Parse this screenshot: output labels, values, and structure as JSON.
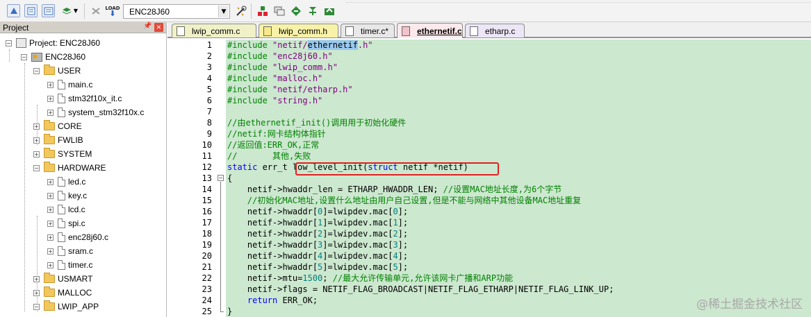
{
  "toolbar": {
    "target_value": "ENC28J60",
    "buttons": [
      "translate-icon",
      "build-icon",
      "rebuild-icon",
      "batch-build-icon",
      "stop-icon",
      "download-icon",
      "target-options-icon",
      "manage-components-icon",
      "file-extensions-icon",
      "runtime-env-icon",
      "pack-installer-icon"
    ]
  },
  "panel": {
    "title": "Project",
    "pin_glyph": "◀",
    "close_glyph": "×"
  },
  "tree": [
    {
      "label": "Project: ENC28J60",
      "kind": "project",
      "depth": 0,
      "expander": "−"
    },
    {
      "label": "ENC28J60",
      "kind": "target",
      "depth": 1,
      "expander": "−"
    },
    {
      "label": "USER",
      "kind": "folder",
      "depth": 2,
      "expander": "−"
    },
    {
      "label": "main.c",
      "kind": "file",
      "depth": 3,
      "expander": "+"
    },
    {
      "label": "stm32f10x_it.c",
      "kind": "file",
      "depth": 3,
      "expander": "+"
    },
    {
      "label": "system_stm32f10x.c",
      "kind": "file",
      "depth": 3,
      "expander": "+"
    },
    {
      "label": "CORE",
      "kind": "folder",
      "depth": 2,
      "expander": "+"
    },
    {
      "label": "FWLIB",
      "kind": "folder",
      "depth": 2,
      "expander": "+"
    },
    {
      "label": "SYSTEM",
      "kind": "folder",
      "depth": 2,
      "expander": "+"
    },
    {
      "label": "HARDWARE",
      "kind": "folder",
      "depth": 2,
      "expander": "−"
    },
    {
      "label": "led.c",
      "kind": "file",
      "depth": 3,
      "expander": "+"
    },
    {
      "label": "key.c",
      "kind": "file",
      "depth": 3,
      "expander": "+"
    },
    {
      "label": "lcd.c",
      "kind": "file",
      "depth": 3,
      "expander": "+"
    },
    {
      "label": "spi.c",
      "kind": "file",
      "depth": 3,
      "expander": "+"
    },
    {
      "label": "enc28j60.c",
      "kind": "file",
      "depth": 3,
      "expander": "+"
    },
    {
      "label": "sram.c",
      "kind": "file",
      "depth": 3,
      "expander": "+"
    },
    {
      "label": "timer.c",
      "kind": "file",
      "depth": 3,
      "expander": "+"
    },
    {
      "label": "USMART",
      "kind": "folder",
      "depth": 2,
      "expander": "+"
    },
    {
      "label": "MALLOC",
      "kind": "folder",
      "depth": 2,
      "expander": "+"
    },
    {
      "label": "LWIP_APP",
      "kind": "folder",
      "depth": 2,
      "expander": "−"
    }
  ],
  "tabs": [
    {
      "label": "lwip_comm.c",
      "color": "#f1f1c8",
      "active": false
    },
    {
      "label": "lwip_comm.h",
      "color": "#f7f2a8",
      "active": false
    },
    {
      "label": "timer.c*",
      "color": "#e8e8e8",
      "active": false
    },
    {
      "label": "ethernetif.c",
      "color": "#fde9ec",
      "active": true
    },
    {
      "label": "etharp.c",
      "color": "#ece6f7",
      "active": false
    }
  ],
  "code_lines": [
    {
      "n": "1",
      "fold": "",
      "segs": [
        [
          "pp",
          "#include "
        ],
        [
          "str",
          "\"netif/"
        ],
        [
          "sel",
          "ethernetif"
        ],
        [
          "str",
          ".h\""
        ]
      ]
    },
    {
      "n": "2",
      "fold": "",
      "segs": [
        [
          "pp",
          "#include "
        ],
        [
          "str",
          "\"enc28j60.h\""
        ]
      ]
    },
    {
      "n": "3",
      "fold": "",
      "segs": [
        [
          "pp",
          "#include "
        ],
        [
          "str",
          "\"lwip_comm.h\""
        ]
      ]
    },
    {
      "n": "4",
      "fold": "",
      "segs": [
        [
          "pp",
          "#include "
        ],
        [
          "str",
          "\"malloc.h\""
        ]
      ]
    },
    {
      "n": "5",
      "fold": "",
      "segs": [
        [
          "pp",
          "#include "
        ],
        [
          "str",
          "\"netif/etharp.h\""
        ]
      ]
    },
    {
      "n": "6",
      "fold": "",
      "segs": [
        [
          "pp",
          "#include "
        ],
        [
          "str",
          "\"string.h\""
        ]
      ]
    },
    {
      "n": "7",
      "fold": "",
      "segs": []
    },
    {
      "n": "8",
      "fold": "",
      "segs": [
        [
          "cmt",
          "//由ethernetif_init()调用用于初始化硬件"
        ]
      ]
    },
    {
      "n": "9",
      "fold": "",
      "segs": [
        [
          "cmt",
          "//netif:网卡结构体指针"
        ]
      ]
    },
    {
      "n": "10",
      "fold": "",
      "segs": [
        [
          "cmt",
          "//返回值:ERR_OK,正常"
        ]
      ]
    },
    {
      "n": "11",
      "fold": "",
      "segs": [
        [
          "cmt",
          "//       其他,失败"
        ]
      ]
    },
    {
      "n": "12",
      "fold": "",
      "segs": [
        [
          "kw",
          "static"
        ],
        [
          "",
          " err_t low_level_init("
        ],
        [
          "kw",
          "struct"
        ],
        [
          "",
          " netif *netif)"
        ]
      ]
    },
    {
      "n": "13",
      "fold": "box",
      "segs": [
        [
          "",
          "{"
        ]
      ]
    },
    {
      "n": "14",
      "fold": "line",
      "segs": [
        [
          "",
          "    netif->hwaddr_len = ETHARP_HWADDR_LEN; "
        ],
        [
          "cmt",
          "//设置MAC地址长度,为6个字节"
        ]
      ]
    },
    {
      "n": "15",
      "fold": "line",
      "segs": [
        [
          "cmt",
          "    //初始化MAC地址,设置什么地址由用户自己设置,但是不能与网络中其他设备MAC地址重复"
        ]
      ]
    },
    {
      "n": "16",
      "fold": "line",
      "segs": [
        [
          "",
          "    netif->hwaddr["
        ],
        [
          "num",
          "0"
        ],
        [
          "",
          "]=lwipdev.mac["
        ],
        [
          "num",
          "0"
        ],
        [
          "",
          "];"
        ]
      ]
    },
    {
      "n": "17",
      "fold": "line",
      "segs": [
        [
          "",
          "    netif->hwaddr["
        ],
        [
          "num",
          "1"
        ],
        [
          "",
          "]=lwipdev.mac["
        ],
        [
          "num",
          "1"
        ],
        [
          "",
          "];"
        ]
      ]
    },
    {
      "n": "18",
      "fold": "line",
      "segs": [
        [
          "",
          "    netif->hwaddr["
        ],
        [
          "num",
          "2"
        ],
        [
          "",
          "]=lwipdev.mac["
        ],
        [
          "num",
          "2"
        ],
        [
          "",
          "];"
        ]
      ]
    },
    {
      "n": "19",
      "fold": "line",
      "segs": [
        [
          "",
          "    netif->hwaddr["
        ],
        [
          "num",
          "3"
        ],
        [
          "",
          "]=lwipdev.mac["
        ],
        [
          "num",
          "3"
        ],
        [
          "",
          "];"
        ]
      ]
    },
    {
      "n": "20",
      "fold": "line",
      "segs": [
        [
          "",
          "    netif->hwaddr["
        ],
        [
          "num",
          "4"
        ],
        [
          "",
          "]=lwipdev.mac["
        ],
        [
          "num",
          "4"
        ],
        [
          "",
          "];"
        ]
      ]
    },
    {
      "n": "21",
      "fold": "line",
      "segs": [
        [
          "",
          "    netif->hwaddr["
        ],
        [
          "num",
          "5"
        ],
        [
          "",
          "]=lwipdev.mac["
        ],
        [
          "num",
          "5"
        ],
        [
          "",
          "];"
        ]
      ]
    },
    {
      "n": "22",
      "fold": "line",
      "segs": [
        [
          "",
          "    netif->mtu="
        ],
        [
          "num",
          "1500"
        ],
        [
          "",
          "; "
        ],
        [
          "cmt",
          "//最大允许传输单元,允许该网卡广播和ARP功能"
        ]
      ]
    },
    {
      "n": "23",
      "fold": "line",
      "segs": [
        [
          "",
          "    netif->flags = NETIF_FLAG_BROADCAST|NETIF_FLAG_ETHARP|NETIF_FLAG_LINK_UP;"
        ]
      ]
    },
    {
      "n": "24",
      "fold": "line",
      "segs": [
        [
          "",
          "    "
        ],
        [
          "kw",
          "return"
        ],
        [
          "",
          " ERR_OK;"
        ]
      ]
    },
    {
      "n": "25",
      "fold": "end",
      "segs": [
        [
          "",
          "}"
        ]
      ]
    }
  ],
  "watermark": "@稀土掘金技术社区"
}
